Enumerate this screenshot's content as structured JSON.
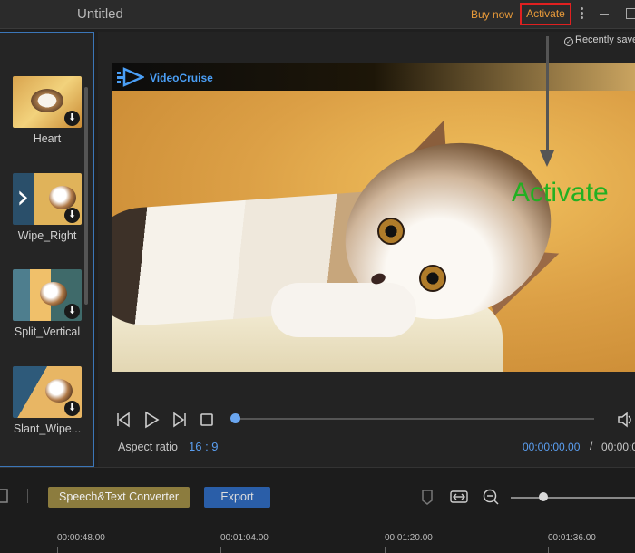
{
  "titlebar": {
    "title": "Untitled",
    "buy_now": "Buy now",
    "activate": "Activate"
  },
  "status": {
    "saved": "Recently save"
  },
  "transitions": [
    {
      "label": "Heart",
      "style": "heart"
    },
    {
      "label": "Wipe_Right",
      "style": "wipe"
    },
    {
      "label": "Split_Vertical",
      "style": "split"
    },
    {
      "label": "Slant_Wipe...",
      "style": "slant"
    }
  ],
  "preview": {
    "watermark": "VideoCruise",
    "annotation": "Activate"
  },
  "playback": {
    "aspect_label": "Aspect ratio",
    "aspect_value": "16 : 9",
    "current_time": "00:00:00.00",
    "separator": "/",
    "total_time": "00:00:0",
    "progress": 0.0
  },
  "toolbar": {
    "speech_button": "Speech&Text Converter",
    "export_button": "Export",
    "zoom_level": 0.25
  },
  "timeline": {
    "ticks": [
      "00:00:48.00",
      "00:01:04.00",
      "00:01:20.00",
      "00:01:36.00"
    ]
  },
  "colors": {
    "accent_blue": "#5a9ef0",
    "buy_orange": "#e89a3a",
    "highlight_red": "#e02020",
    "annotation_green": "#22b022",
    "speech_button_bg": "#8c7c3e",
    "export_button_bg": "#2a5ea8"
  }
}
